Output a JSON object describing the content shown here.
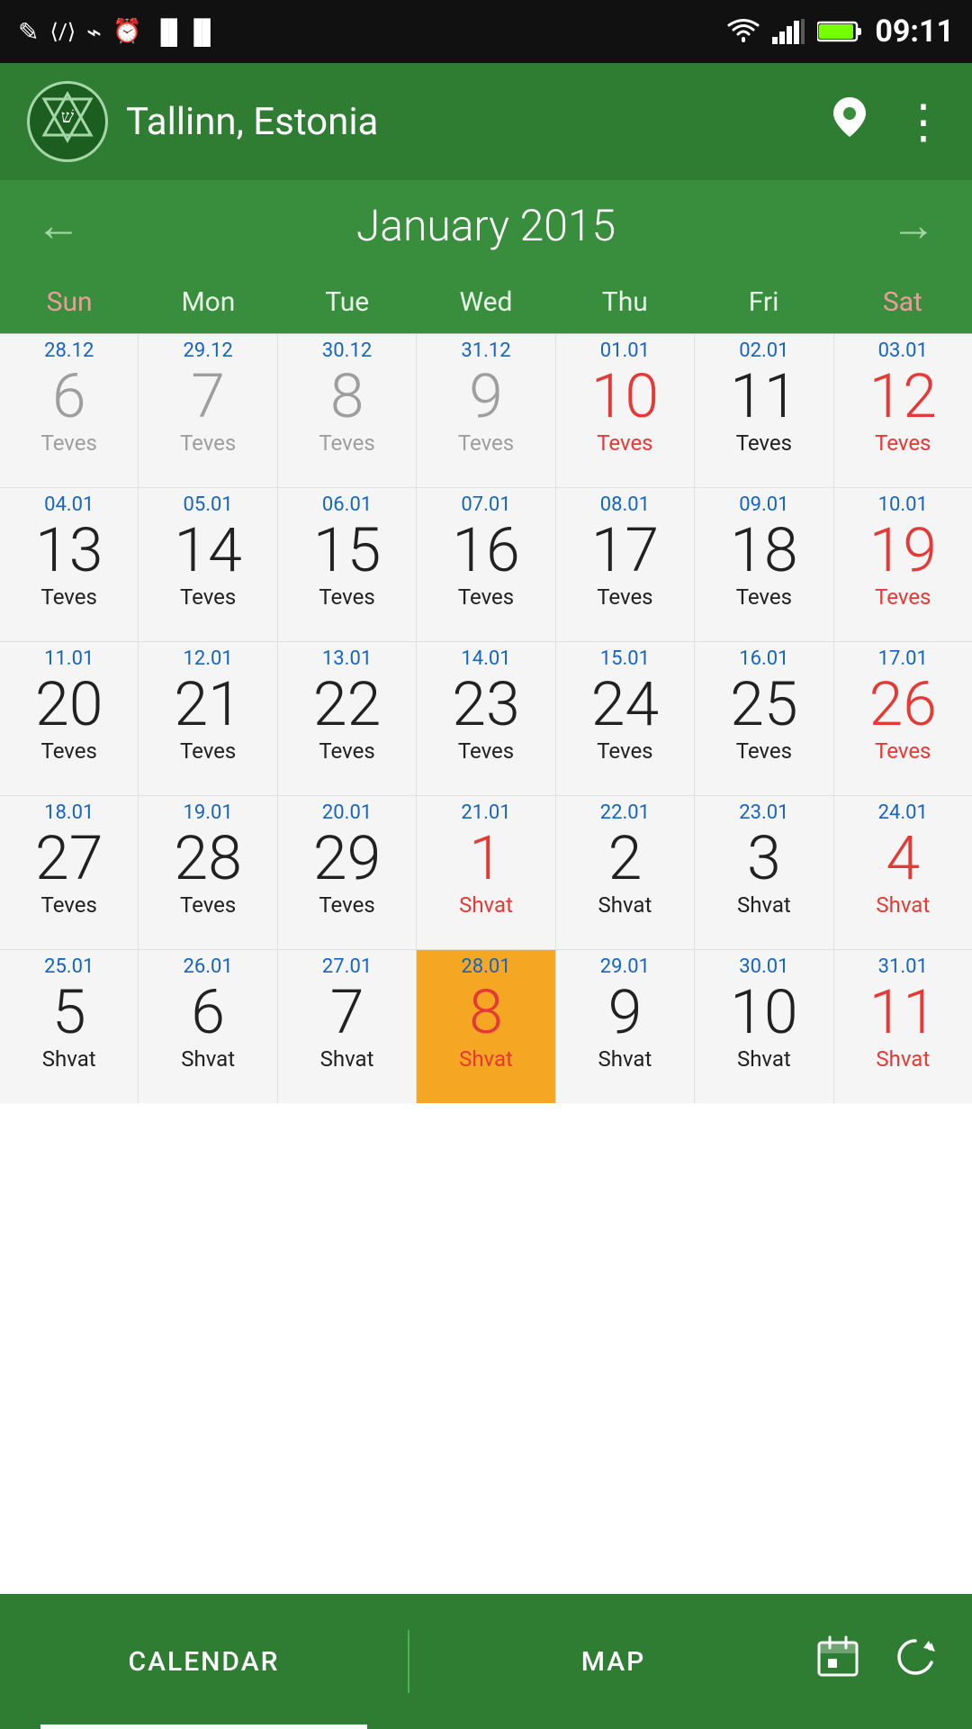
{
  "statusBar": {
    "time": "09:11",
    "leftIcons": [
      "✎",
      "⟨⟩",
      "⌁",
      "⊙",
      "▐▌▐"
    ],
    "rightIcons": [
      "wifi",
      "signal",
      "battery"
    ]
  },
  "header": {
    "logoText": "שׁ",
    "title": "Tallinn, Estonia",
    "locationIconLabel": "location-icon",
    "moreIconLabel": "more-icon"
  },
  "monthNav": {
    "prevLabel": "←",
    "nextLabel": "→",
    "monthYear": "January 2015"
  },
  "daysOfWeek": [
    "Sun",
    "Mon",
    "Tue",
    "Wed",
    "Thu",
    "Fri",
    "Sat"
  ],
  "weeks": [
    [
      {
        "smallDate": "28.12",
        "num": "6",
        "hebrew": "Teves",
        "numColor": "gray",
        "hebColor": "gray",
        "isToday": false,
        "isPrev": true
      },
      {
        "smallDate": "29.12",
        "num": "7",
        "hebrew": "Teves",
        "numColor": "gray",
        "hebColor": "gray",
        "isToday": false,
        "isPrev": true
      },
      {
        "smallDate": "30.12",
        "num": "8",
        "hebrew": "Teves",
        "numColor": "gray",
        "hebColor": "gray",
        "isToday": false,
        "isPrev": true
      },
      {
        "smallDate": "31.12",
        "num": "9",
        "hebrew": "Teves",
        "numColor": "gray",
        "hebColor": "gray",
        "isToday": false,
        "isPrev": true
      },
      {
        "smallDate": "01.01",
        "num": "10",
        "hebrew": "Teves",
        "numColor": "red",
        "hebColor": "red",
        "isToday": false,
        "isPrev": false
      },
      {
        "smallDate": "02.01",
        "num": "11",
        "hebrew": "Teves",
        "numColor": "black",
        "hebColor": "black",
        "isToday": false,
        "isPrev": false
      },
      {
        "smallDate": "03.01",
        "num": "12",
        "hebrew": "Teves",
        "numColor": "red",
        "hebColor": "red",
        "isToday": false,
        "isPrev": false
      }
    ],
    [
      {
        "smallDate": "04.01",
        "num": "13",
        "hebrew": "Teves",
        "numColor": "black",
        "hebColor": "black",
        "isToday": false,
        "isPrev": false
      },
      {
        "smallDate": "05.01",
        "num": "14",
        "hebrew": "Teves",
        "numColor": "black",
        "hebColor": "black",
        "isToday": false,
        "isPrev": false
      },
      {
        "smallDate": "06.01",
        "num": "15",
        "hebrew": "Teves",
        "numColor": "black",
        "hebColor": "black",
        "isToday": false,
        "isPrev": false
      },
      {
        "smallDate": "07.01",
        "num": "16",
        "hebrew": "Teves",
        "numColor": "black",
        "hebColor": "black",
        "isToday": false,
        "isPrev": false
      },
      {
        "smallDate": "08.01",
        "num": "17",
        "hebrew": "Teves",
        "numColor": "black",
        "hebColor": "black",
        "isToday": false,
        "isPrev": false
      },
      {
        "smallDate": "09.01",
        "num": "18",
        "hebrew": "Teves",
        "numColor": "black",
        "hebColor": "black",
        "isToday": false,
        "isPrev": false
      },
      {
        "smallDate": "10.01",
        "num": "19",
        "hebrew": "Teves",
        "numColor": "red",
        "hebColor": "red",
        "isToday": false,
        "isPrev": false
      }
    ],
    [
      {
        "smallDate": "11.01",
        "num": "20",
        "hebrew": "Teves",
        "numColor": "black",
        "hebColor": "black",
        "isToday": false,
        "isPrev": false
      },
      {
        "smallDate": "12.01",
        "num": "21",
        "hebrew": "Teves",
        "numColor": "black",
        "hebColor": "black",
        "isToday": false,
        "isPrev": false
      },
      {
        "smallDate": "13.01",
        "num": "22",
        "hebrew": "Teves",
        "numColor": "black",
        "hebColor": "black",
        "isToday": false,
        "isPrev": false
      },
      {
        "smallDate": "14.01",
        "num": "23",
        "hebrew": "Teves",
        "numColor": "black",
        "hebColor": "black",
        "isToday": false,
        "isPrev": false
      },
      {
        "smallDate": "15.01",
        "num": "24",
        "hebrew": "Teves",
        "numColor": "black",
        "hebColor": "black",
        "isToday": false,
        "isPrev": false
      },
      {
        "smallDate": "16.01",
        "num": "25",
        "hebrew": "Teves",
        "numColor": "black",
        "hebColor": "black",
        "isToday": false,
        "isPrev": false
      },
      {
        "smallDate": "17.01",
        "num": "26",
        "hebrew": "Teves",
        "numColor": "red",
        "hebColor": "red",
        "isToday": false,
        "isPrev": false
      }
    ],
    [
      {
        "smallDate": "18.01",
        "num": "27",
        "hebrew": "Teves",
        "numColor": "black",
        "hebColor": "black",
        "isToday": false,
        "isPrev": false
      },
      {
        "smallDate": "19.01",
        "num": "28",
        "hebrew": "Teves",
        "numColor": "black",
        "hebColor": "black",
        "isToday": false,
        "isPrev": false
      },
      {
        "smallDate": "20.01",
        "num": "29",
        "hebrew": "Teves",
        "numColor": "black",
        "hebColor": "black",
        "isToday": false,
        "isPrev": false
      },
      {
        "smallDate": "21.01",
        "num": "1",
        "hebrew": "Shvat",
        "numColor": "red",
        "hebColor": "red",
        "isToday": false,
        "isPrev": false
      },
      {
        "smallDate": "22.01",
        "num": "2",
        "hebrew": "Shvat",
        "numColor": "black",
        "hebColor": "black",
        "isToday": false,
        "isPrev": false
      },
      {
        "smallDate": "23.01",
        "num": "3",
        "hebrew": "Shvat",
        "numColor": "black",
        "hebColor": "black",
        "isToday": false,
        "isPrev": false
      },
      {
        "smallDate": "24.01",
        "num": "4",
        "hebrew": "Shvat",
        "numColor": "red",
        "hebColor": "red",
        "isToday": false,
        "isPrev": false
      }
    ],
    [
      {
        "smallDate": "25.01",
        "num": "5",
        "hebrew": "Shvat",
        "numColor": "black",
        "hebColor": "black",
        "isToday": false,
        "isPrev": false
      },
      {
        "smallDate": "26.01",
        "num": "6",
        "hebrew": "Shvat",
        "numColor": "black",
        "hebColor": "black",
        "isToday": false,
        "isPrev": false
      },
      {
        "smallDate": "27.01",
        "num": "7",
        "hebrew": "Shvat",
        "numColor": "black",
        "hebColor": "black",
        "isToday": false,
        "isPrev": false
      },
      {
        "smallDate": "28.01",
        "num": "8",
        "hebrew": "Shvat",
        "numColor": "red",
        "hebColor": "red",
        "isToday": true,
        "isPrev": false
      },
      {
        "smallDate": "29.01",
        "num": "9",
        "hebrew": "Shvat",
        "numColor": "black",
        "hebColor": "black",
        "isToday": false,
        "isPrev": false
      },
      {
        "smallDate": "30.01",
        "num": "10",
        "hebrew": "Shvat",
        "numColor": "black",
        "hebColor": "black",
        "isToday": false,
        "isPrev": false
      },
      {
        "smallDate": "31.01",
        "num": "11",
        "hebrew": "Shvat",
        "numColor": "red",
        "hebColor": "red",
        "isToday": false,
        "isPrev": false
      }
    ]
  ],
  "bottomBar": {
    "tabs": [
      {
        "label": "CALENDAR",
        "active": true
      },
      {
        "label": "MAP",
        "active": false
      }
    ],
    "actions": [
      {
        "icon": "calendar-today-icon"
      },
      {
        "icon": "refresh-icon"
      }
    ]
  }
}
